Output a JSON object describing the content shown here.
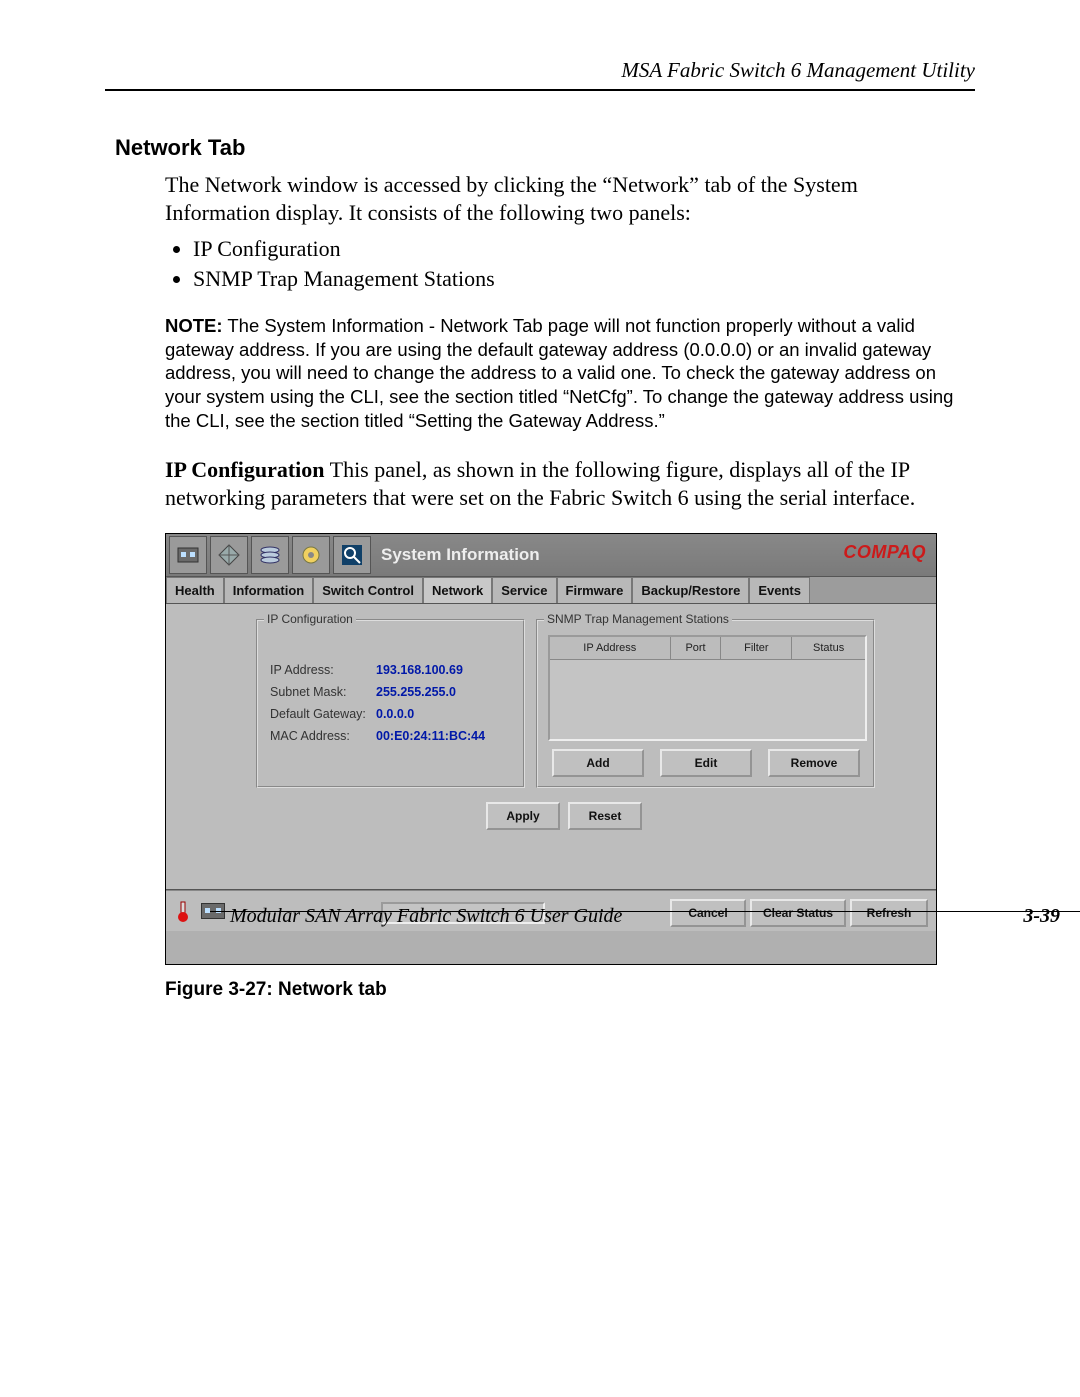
{
  "doc": {
    "running_head": "MSA Fabric Switch 6 Management Utility",
    "section_title": "Network Tab",
    "intro": "The Network window is accessed by clicking the “Network” tab of the System Information display. It consists of the following two panels:",
    "bullets": [
      "IP Configuration",
      "SNMP Trap Management Stations"
    ],
    "note_label": "NOTE:",
    "note_body": "  The System Information - Network Tab page will not function properly without a valid gateway address. If you are using the default gateway address (0.0.0.0) or an invalid gateway address, you will need to change the address to a valid one. To check the gateway address on your system using the CLI, see the section titled “NetCfg”. To change the gateway address using the CLI, see the section titled “Setting the Gateway Address.”",
    "ipconf_lead": "IP Configuration",
    "ipconf_rest": " This panel, as shown in the following figure, displays all of the IP networking parameters that were set on the Fabric Switch 6 using the serial interface.",
    "fig_caption": "Figure 3-27:  Network tab",
    "footer_left": "Modular SAN Array Fabric Switch 6 User Guide",
    "footer_right": "3-39"
  },
  "app": {
    "brand": "COMPAQ",
    "title": "System Information",
    "tabs": [
      "Health",
      "Information",
      "Switch Control",
      "Network",
      "Service",
      "Firmware",
      "Backup/Restore",
      "Events"
    ],
    "selected_tab_index": 3,
    "ip_panel": {
      "legend": "IP Configuration",
      "rows": [
        {
          "label": "IP Address:",
          "value": "193.168.100.69"
        },
        {
          "label": "Subnet Mask:",
          "value": "255.255.255.0"
        },
        {
          "label": "Default Gateway:",
          "value": "0.0.0.0"
        },
        {
          "label": "MAC Address:",
          "value": "00:E0:24:11:BC:44"
        }
      ]
    },
    "snmp_panel": {
      "legend": "SNMP Trap Management Stations",
      "columns": [
        "IP Address",
        "Port",
        "Filter",
        "Status"
      ],
      "buttons": {
        "add": "Add",
        "edit": "Edit",
        "remove": "Remove"
      }
    },
    "buttons": {
      "apply": "Apply",
      "reset": "Reset",
      "cancel": "Cancel",
      "clear": "Clear Status",
      "refresh": "Refresh"
    }
  }
}
